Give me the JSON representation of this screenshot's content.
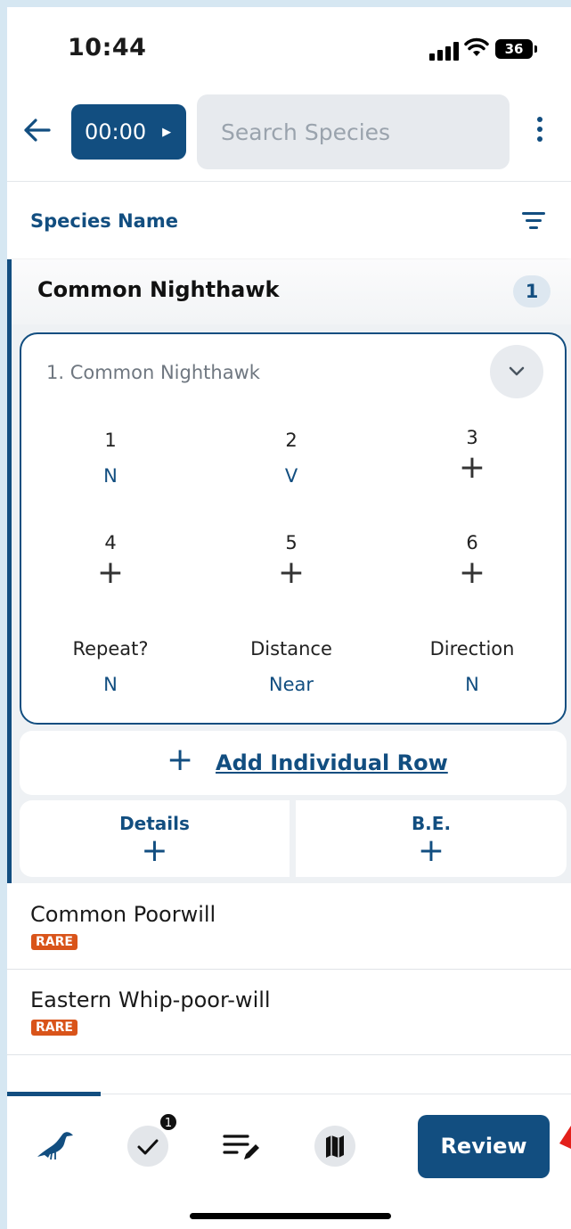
{
  "status_bar": {
    "time": "10:44",
    "battery": "36"
  },
  "header": {
    "timer": "00:00",
    "search_placeholder": "Search Species"
  },
  "sort": {
    "label": "Species Name"
  },
  "expanded_species": {
    "name": "Common Nighthawk",
    "count": "1",
    "card_title": "1. Common Nighthawk",
    "cells": [
      {
        "label": "1",
        "value": "N"
      },
      {
        "label": "2",
        "value": "V"
      },
      {
        "label": "3",
        "value": "+"
      },
      {
        "label": "4",
        "value": "+"
      },
      {
        "label": "5",
        "value": "+"
      },
      {
        "label": "6",
        "value": "+"
      }
    ],
    "attributes": [
      {
        "label": "Repeat?",
        "value": "N"
      },
      {
        "label": "Distance",
        "value": "Near"
      },
      {
        "label": "Direction",
        "value": "N"
      }
    ],
    "add_row_label": "Add Individual Row",
    "details_label": "Details",
    "be_label": "B.E."
  },
  "species_list": [
    {
      "name": "Common Poorwill",
      "badge": "RARE"
    },
    {
      "name": "Eastern Whip-poor-will",
      "badge": "RARE"
    }
  ],
  "bottom_nav": {
    "checklist_badge": "1",
    "review_label": "Review"
  },
  "colors": {
    "primary": "#124e80",
    "rare": "#d9541a",
    "background": "#d6e7f2"
  },
  "icons": [
    "back-arrow-icon",
    "play-icon",
    "kebab-menu-icon",
    "filter-icon",
    "chevron-down-icon",
    "bird-icon",
    "check-icon",
    "edit-list-icon",
    "map-icon"
  ]
}
